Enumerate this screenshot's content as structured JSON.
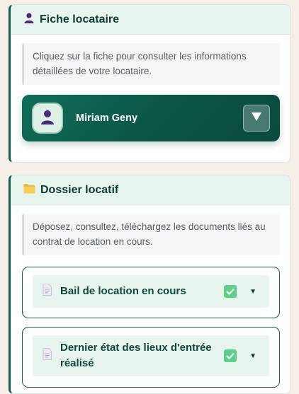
{
  "tenant_card": {
    "title": "Fiche locataire",
    "info": "Cliquez sur la fiche pour consulter les informations détaillées de votre locataire.",
    "tenant_name": "Miriam Geny",
    "expand_icon": "▼"
  },
  "file_card": {
    "title": "Dossier locatif",
    "info": "Déposez, consultez, téléchargez les documents liés au contrat de location en cours.",
    "documents": [
      {
        "label": "Bail de location en cours",
        "checked": true
      },
      {
        "label": "Dernier état des lieux d'entrée réalisé",
        "checked": true
      }
    ]
  },
  "colors": {
    "accent": "#0f5c4a",
    "header_bg": "#e8f4ee",
    "check": "#5ccf8d",
    "page_bg": "#f5eee9"
  },
  "icons": [
    "user-icon",
    "folder-icon",
    "document-icon",
    "checkbox-checked-icon",
    "caret-down-icon"
  ]
}
